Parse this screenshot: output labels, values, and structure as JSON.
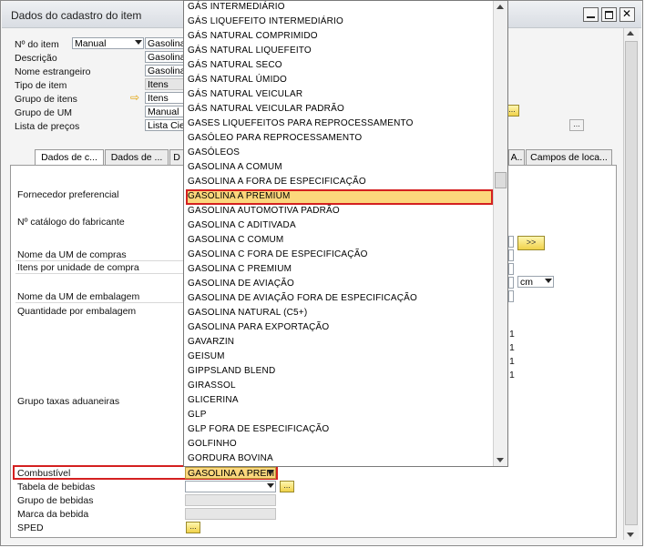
{
  "window": {
    "title": "Dados do cadastro do item"
  },
  "header_fields": {
    "item_no_label": "Nº do item",
    "item_no_mode": "Manual",
    "item_no_value": "Gasolina",
    "description_label": "Descrição",
    "description_value": "Gasolina",
    "foreign_name_label": "Nome estrangeiro",
    "foreign_name_value": "Gasolina",
    "item_type_label": "Tipo de item",
    "item_type_value": "Itens",
    "item_group_label": "Grupo de itens",
    "item_group_value": "Itens",
    "uom_group_label": "Grupo de UM",
    "uom_group_value": "Manual",
    "price_list_label": "Lista de preços",
    "price_list_value": "Lista Cien"
  },
  "tabs": [
    {
      "label": "Dados de c..."
    },
    {
      "label": "Dados de ..."
    },
    {
      "label": "D"
    },
    {
      "label": "A.."
    },
    {
      "label": "Campos de loca..."
    }
  ],
  "form": {
    "preferred_vendor": "Fornecedor preferencial",
    "mfr_catalog_no": "Nº catálogo do fabricante",
    "purchase_uom_name": "Nome da UM de compras",
    "items_per_purchase_unit": "Itens por unidade de compra",
    "packaging_uom_name": "Nome da UM de embalagem",
    "qty_per_package": "Quantidade por embalagem",
    "customs_group": "Grupo taxas aduaneiras",
    "fuel_label": "Combustível",
    "fuel_value": "GASOLINA A PREMIUM",
    "beverage_table": "Tabela de bebidas",
    "beverage_group": "Grupo de bebidas",
    "beverage_brand": "Marca da bebida",
    "sped": "SPED",
    "arrow_button": ">>",
    "unit_cm": "cm",
    "dots": "...",
    "ones": [
      "1",
      "1",
      "1",
      "1"
    ]
  },
  "dropdown_options": [
    "GÁS INTERMEDIÁRIO",
    "GÁS LIQUEFEITO INTERMEDIÁRIO",
    "GÁS NATURAL COMPRIMIDO",
    "GÁS NATURAL LIQUEFEITO",
    "GÁS NATURAL SECO",
    "GÁS NATURAL ÚMIDO",
    "GÁS NATURAL VEICULAR",
    "GÁS NATURAL VEICULAR PADRÃO",
    "GASES LIQUEFEITOS PARA REPROCESSAMENTO",
    "GASÓLEO PARA REPROCESSAMENTO",
    "GASÓLEOS",
    "GASOLINA A COMUM",
    "GASOLINA A FORA DE ESPECIFICAÇÃO",
    "GASOLINA A PREMIUM",
    "GASOLINA AUTOMOTIVA PADRÃO",
    "GASOLINA C ADITIVADA",
    "GASOLINA C COMUM",
    "GASOLINA C FORA DE ESPECIFICAÇÃO",
    "GASOLINA C PREMIUM",
    "GASOLINA DE AVIAÇÃO",
    "GASOLINA DE AVIAÇÃO FORA DE ESPECIFICAÇÃO",
    "GASOLINA NATURAL (C5+)",
    "GASOLINA PARA EXPORTAÇÃO",
    "GAVARZIN",
    "GEISUM",
    "GIPPSLAND BLEND",
    "GIRASSOL",
    "GLICERINA",
    "GLP",
    "GLP FORA DE ESPECIFICAÇÃO",
    "GOLFINHO",
    "GORDURA BOVINA"
  ],
  "selected_option_index": 13,
  "colors": {
    "highlight": "#fcd77c",
    "focus_border": "#d42020",
    "button_yellow": "#f0d24a"
  }
}
